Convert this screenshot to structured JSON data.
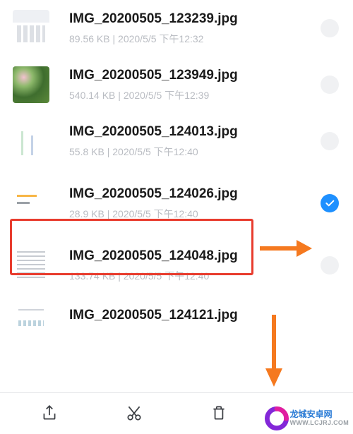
{
  "files": [
    {
      "name": "IMG_20200505_123239.jpg",
      "size": "89.56 KB",
      "date": "2020/5/5 下午12:32",
      "selected": false
    },
    {
      "name": "IMG_20200505_123949.jpg",
      "size": "540.14 KB",
      "date": "2020/5/5 下午12:39",
      "selected": false
    },
    {
      "name": "IMG_20200505_124013.jpg",
      "size": "55.8 KB",
      "date": "2020/5/5 下午12:40",
      "selected": false
    },
    {
      "name": "IMG_20200505_124026.jpg",
      "size": "28.9 KB",
      "date": "2020/5/5 下午12:40",
      "selected": true
    },
    {
      "name": "IMG_20200505_124048.jpg",
      "size": "133.74 KB",
      "date": "2020/5/5 下午12:40",
      "selected": false
    },
    {
      "name": "IMG_20200505_124121.jpg",
      "size": "",
      "date": "",
      "selected": false
    }
  ],
  "meta_separator": "  |  ",
  "watermark": {
    "cn": "龙城安卓网",
    "url": "WWW.LCJRJ.COM"
  }
}
